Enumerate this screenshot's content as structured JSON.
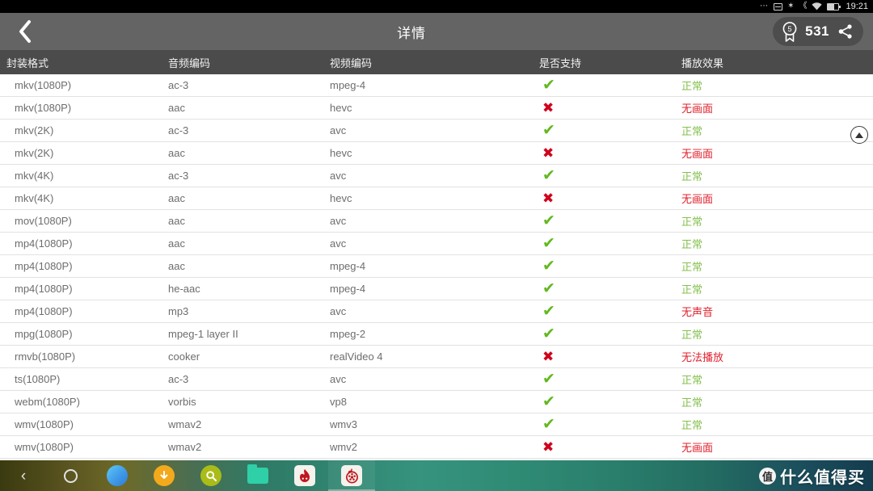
{
  "status_bar": {
    "dots": "⋯",
    "icons": [
      "sd-card-icon",
      "bluetooth-icon",
      "vibrate-icon",
      "wifi-icon",
      "battery-icon"
    ],
    "bluetooth_glyph": "✶",
    "vibrate_glyph": "《",
    "wifi_glyph": "◠",
    "time": "19:21"
  },
  "title_bar": {
    "back_label": "back-chevron",
    "title": "详情",
    "badge_number": "5",
    "count": "531",
    "share_label": "share"
  },
  "table": {
    "headers": [
      "封装格式",
      "音频编码",
      "视频编码",
      "是否支持",
      "播放效果"
    ],
    "yes_mark": "✔",
    "no_mark": "✖",
    "rows": [
      {
        "format": "mkv(1080P)",
        "audio": "ac-3",
        "video": "mpeg-4",
        "supported": true,
        "effect": "正常",
        "effect_ok": true
      },
      {
        "format": "mkv(1080P)",
        "audio": "aac",
        "video": "hevc",
        "supported": false,
        "effect": "无画面",
        "effect_ok": false
      },
      {
        "format": "mkv(2K)",
        "audio": "ac-3",
        "video": "avc",
        "supported": true,
        "effect": "正常",
        "effect_ok": true
      },
      {
        "format": "mkv(2K)",
        "audio": "aac",
        "video": "hevc",
        "supported": false,
        "effect": "无画面",
        "effect_ok": false
      },
      {
        "format": "mkv(4K)",
        "audio": "ac-3",
        "video": "avc",
        "supported": true,
        "effect": "正常",
        "effect_ok": true
      },
      {
        "format": "mkv(4K)",
        "audio": "aac",
        "video": "hevc",
        "supported": false,
        "effect": "无画面",
        "effect_ok": false
      },
      {
        "format": "mov(1080P)",
        "audio": "aac",
        "video": "avc",
        "supported": true,
        "effect": "正常",
        "effect_ok": true
      },
      {
        "format": "mp4(1080P)",
        "audio": "aac",
        "video": "avc",
        "supported": true,
        "effect": "正常",
        "effect_ok": true
      },
      {
        "format": "mp4(1080P)",
        "audio": "aac",
        "video": "mpeg-4",
        "supported": true,
        "effect": "正常",
        "effect_ok": true
      },
      {
        "format": "mp4(1080P)",
        "audio": "he-aac",
        "video": "mpeg-4",
        "supported": true,
        "effect": "正常",
        "effect_ok": true
      },
      {
        "format": "mp4(1080P)",
        "audio": "mp3",
        "video": "avc",
        "supported": true,
        "effect": "无声音",
        "effect_ok": false
      },
      {
        "format": "mpg(1080P)",
        "audio": "mpeg-1 layer II",
        "video": "mpeg-2",
        "supported": true,
        "effect": "正常",
        "effect_ok": true
      },
      {
        "format": "rmvb(1080P)",
        "audio": "cooker",
        "video": "realVideo 4",
        "supported": false,
        "effect": "无法播放",
        "effect_ok": false
      },
      {
        "format": "ts(1080P)",
        "audio": "ac-3",
        "video": "avc",
        "supported": true,
        "effect": "正常",
        "effect_ok": true
      },
      {
        "format": "webm(1080P)",
        "audio": "vorbis",
        "video": "vp8",
        "supported": true,
        "effect": "正常",
        "effect_ok": true
      },
      {
        "format": "wmv(1080P)",
        "audio": "wmav2",
        "video": "wmv3",
        "supported": true,
        "effect": "正常",
        "effect_ok": true
      },
      {
        "format": "wmv(1080P)",
        "audio": "wmav2",
        "video": "wmv2",
        "supported": false,
        "effect": "无画面",
        "effect_ok": false
      }
    ]
  },
  "scroll_top": {
    "label": "scroll-to-top"
  },
  "taskbar": {
    "items": [
      {
        "name": "nav-back",
        "glyph": "‹",
        "kind": "glyph"
      },
      {
        "name": "nav-home",
        "glyph": "",
        "kind": "ring"
      },
      {
        "name": "app-browser",
        "glyph": "",
        "kind": "blue"
      },
      {
        "name": "app-downloads",
        "glyph": "⬇",
        "kind": "orange"
      },
      {
        "name": "app-search",
        "glyph": "ὐd",
        "kind": "olive"
      },
      {
        "name": "app-files",
        "glyph": "",
        "kind": "folder"
      },
      {
        "name": "app-flame",
        "glyph": "",
        "kind": "square-flame"
      },
      {
        "name": "app-video-player",
        "glyph": "",
        "kind": "square-reel"
      }
    ]
  },
  "watermark": {
    "logo_char": "值",
    "text": "什么值得买"
  },
  "colors": {
    "header_bg": "#4b4b4b",
    "titlebar_bg": "#646464",
    "ok_green": "#84c04e",
    "check_green": "#63b820",
    "bad_red": "#e0202c",
    "cross_red": "#d0021b",
    "row_text": "#6d6d6d"
  }
}
